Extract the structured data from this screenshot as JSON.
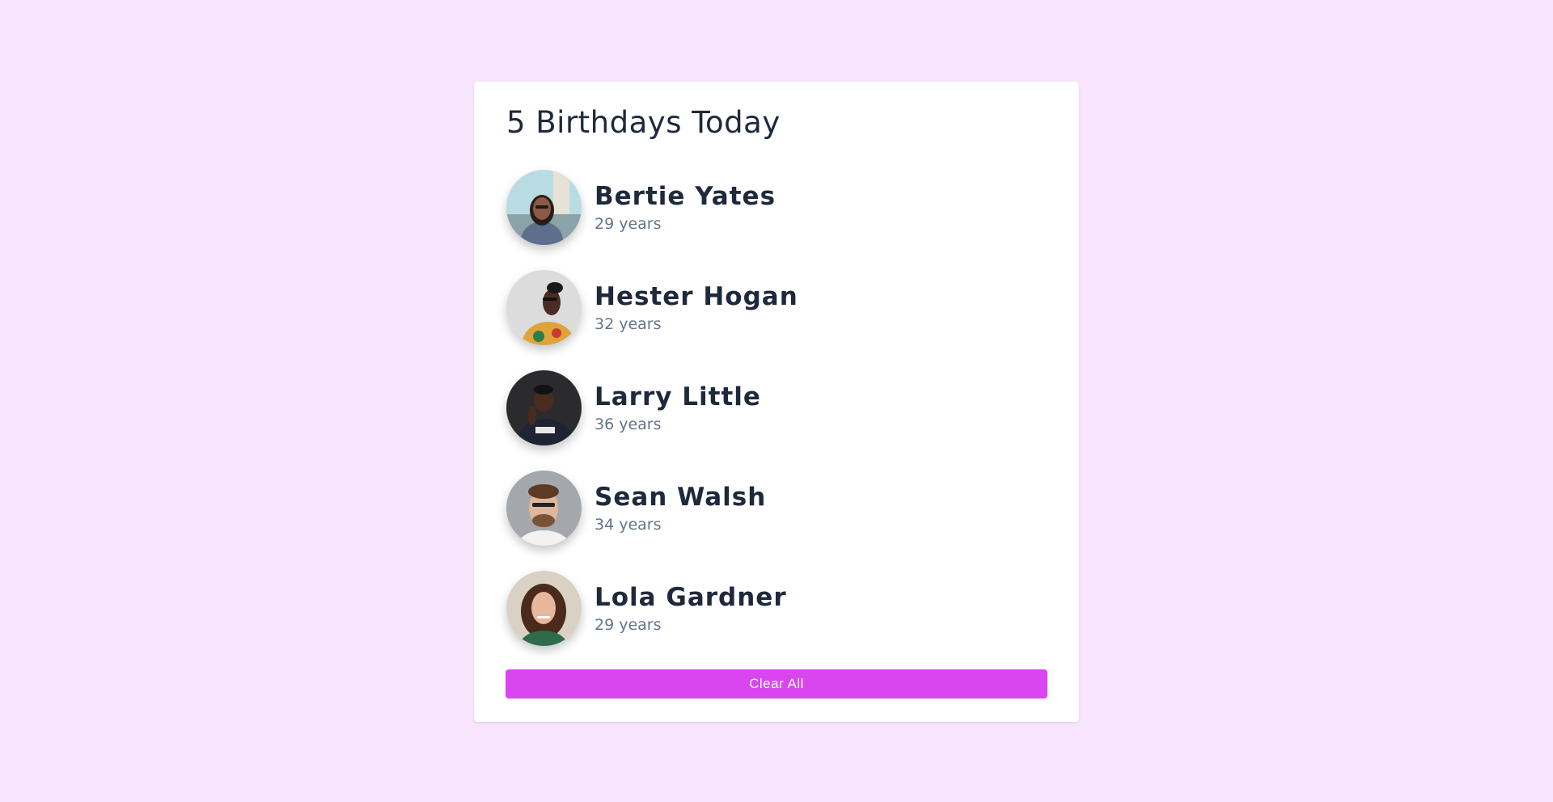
{
  "title": "5 Birthdays Today",
  "people": [
    {
      "name": "Bertie Yates",
      "age": "29 years"
    },
    {
      "name": "Hester Hogan",
      "age": "32 years"
    },
    {
      "name": "Larry Little",
      "age": "36 years"
    },
    {
      "name": "Sean Walsh",
      "age": "34 years"
    },
    {
      "name": "Lola Gardner",
      "age": "29 years"
    }
  ],
  "clear_label": "Clear All",
  "colors": {
    "background": "#f8e5fd",
    "accent": "#d946ef",
    "heading": "#1e293b",
    "muted": "#64748b"
  }
}
